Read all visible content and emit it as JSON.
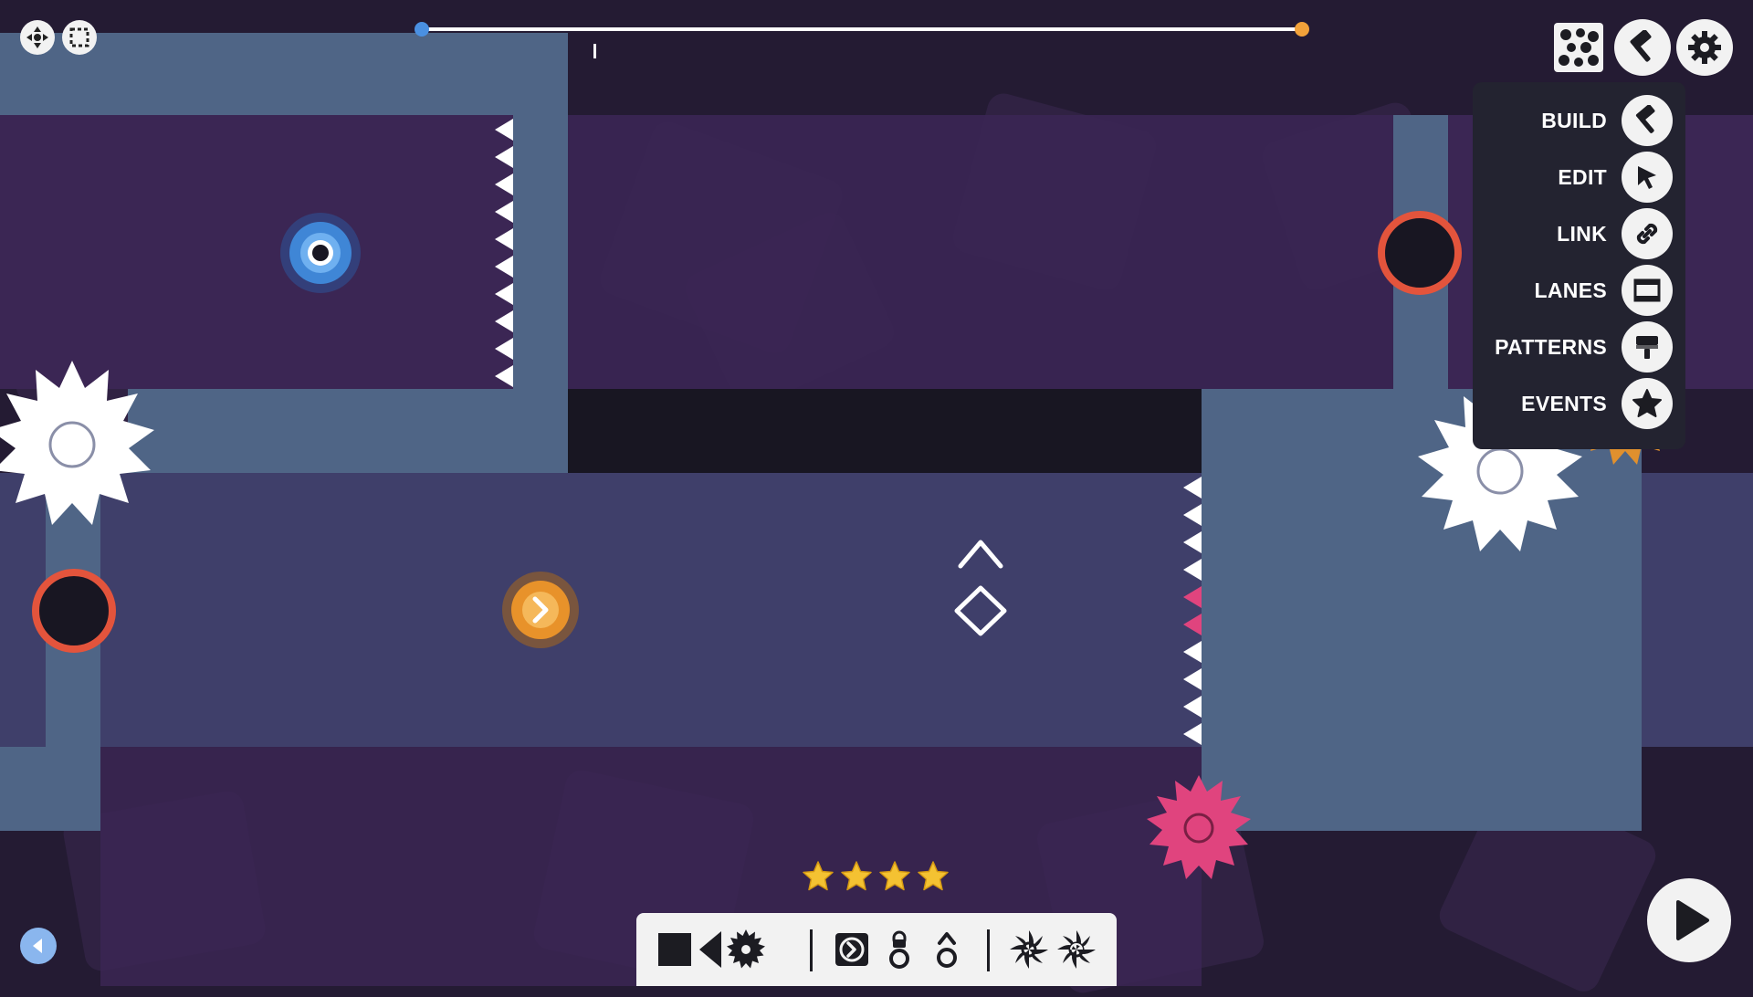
{
  "tool_menu": {
    "items": [
      {
        "label": "BUILD",
        "icon": "hammer-icon"
      },
      {
        "label": "EDIT",
        "icon": "cursor-icon"
      },
      {
        "label": "LINK",
        "icon": "link-icon"
      },
      {
        "label": "LANES",
        "icon": "lanes-icon"
      },
      {
        "label": "PATTERNS",
        "icon": "paint-roller-icon"
      },
      {
        "label": "EVENTS",
        "icon": "star-icon"
      }
    ]
  },
  "header_icons": [
    "move-icon",
    "select-box-icon",
    "pattern-icon",
    "hammer-icon",
    "gear-icon"
  ],
  "timeline": {
    "progress": 0.196
  },
  "rating": {
    "stars": 4
  },
  "palette": {
    "items": [
      "block-icon",
      "wedge-spike-icon",
      "sawblade-icon",
      "portal-exit-icon",
      "lock-icon",
      "balloon-icon",
      "shuriken-icon",
      "double-shuriken-icon"
    ]
  },
  "colors": {
    "slate": "#4f6586",
    "purple": "#3b2654",
    "blue_player": "#4a90e2",
    "orange_player": "#f2a23a",
    "red_ring": "#e3543c",
    "pink_saw": "#e0447e"
  }
}
